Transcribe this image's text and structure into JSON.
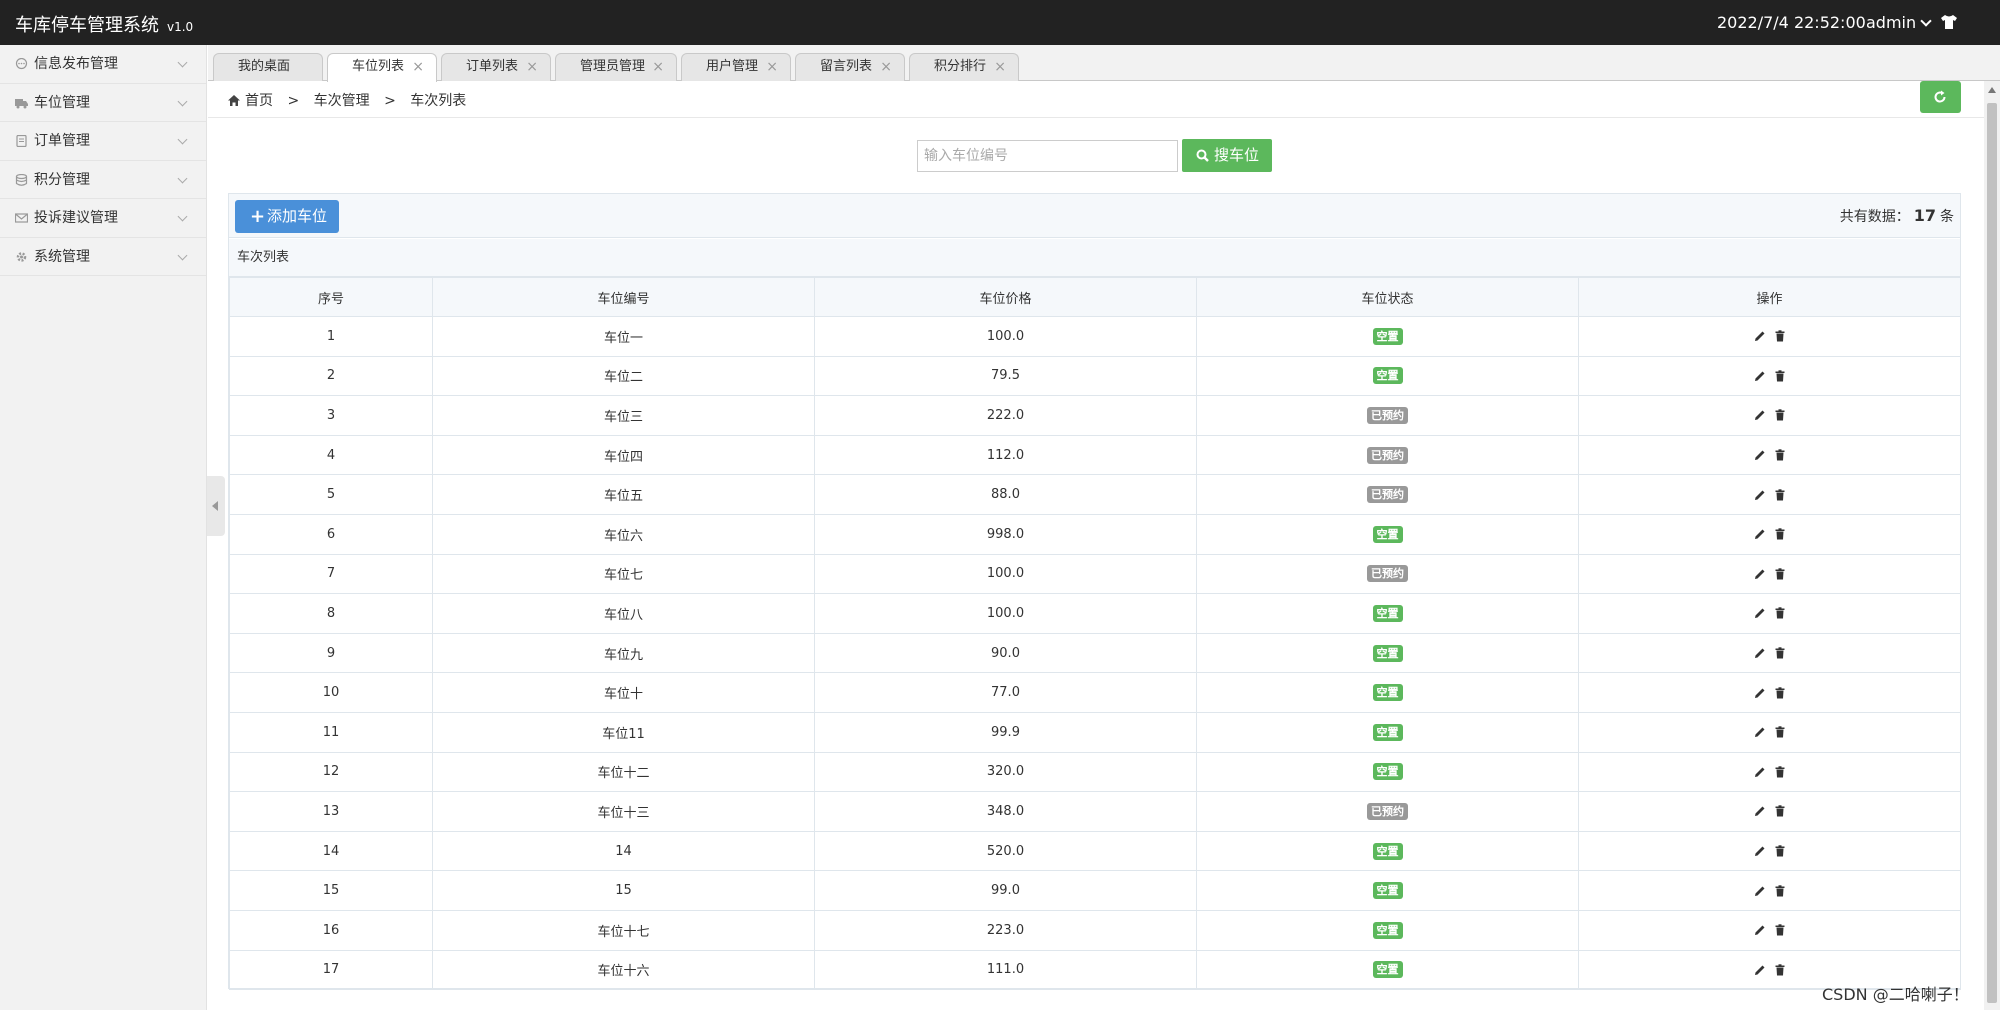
{
  "app": {
    "title": "车库停车管理系统",
    "version": "v1.0",
    "datetime": "2022/7/4 22:52:00",
    "user": "admin"
  },
  "sidebar": {
    "items": [
      {
        "label": "信息发布管理",
        "icon": "chat-icon"
      },
      {
        "label": "车位管理",
        "icon": "truck-icon"
      },
      {
        "label": "订单管理",
        "icon": "document-icon"
      },
      {
        "label": "积分管理",
        "icon": "database-icon"
      },
      {
        "label": "投诉建议管理",
        "icon": "envelope-icon"
      },
      {
        "label": "系统管理",
        "icon": "gear-icon"
      }
    ]
  },
  "tabs": [
    {
      "label": "我的桌面",
      "closable": false
    },
    {
      "label": "车位列表",
      "closable": true,
      "active": true
    },
    {
      "label": "订单列表",
      "closable": true
    },
    {
      "label": "管理员管理",
      "closable": true
    },
    {
      "label": "用户管理",
      "closable": true
    },
    {
      "label": "留言列表",
      "closable": true
    },
    {
      "label": "积分排行",
      "closable": true
    }
  ],
  "breadcrumb": {
    "home": "首页",
    "sep": ">",
    "level2": "车次管理",
    "level3": "车次列表"
  },
  "search": {
    "placeholder": "输入车位编号",
    "button": "搜车位"
  },
  "toolbar": {
    "add_label": "添加车位",
    "count_prefix": "共有数据：",
    "count": "17",
    "count_suffix": "条"
  },
  "table": {
    "title": "车次列表",
    "columns": [
      "序号",
      "车位编号",
      "车位价格",
      "车位状态",
      "操作"
    ],
    "rows": [
      {
        "id": "1",
        "code": "车位一",
        "price": "100.0",
        "status": "空置"
      },
      {
        "id": "2",
        "code": "车位二",
        "price": "79.5",
        "status": "空置"
      },
      {
        "id": "3",
        "code": "车位三",
        "price": "222.0",
        "status": "已预约"
      },
      {
        "id": "4",
        "code": "车位四",
        "price": "112.0",
        "status": "已预约"
      },
      {
        "id": "5",
        "code": "车位五",
        "price": "88.0",
        "status": "已预约"
      },
      {
        "id": "6",
        "code": "车位六",
        "price": "998.0",
        "status": "空置"
      },
      {
        "id": "7",
        "code": "车位七",
        "price": "100.0",
        "status": "已预约"
      },
      {
        "id": "8",
        "code": "车位八",
        "price": "100.0",
        "status": "空置"
      },
      {
        "id": "9",
        "code": "车位九",
        "price": "90.0",
        "status": "空置"
      },
      {
        "id": "10",
        "code": "车位十",
        "price": "77.0",
        "status": "空置"
      },
      {
        "id": "11",
        "code": "车位11",
        "price": "99.9",
        "status": "空置"
      },
      {
        "id": "12",
        "code": "车位十二",
        "price": "320.0",
        "status": "空置"
      },
      {
        "id": "13",
        "code": "车位十三",
        "price": "348.0",
        "status": "已预约"
      },
      {
        "id": "14",
        "code": "14",
        "price": "520.0",
        "status": "空置"
      },
      {
        "id": "15",
        "code": "15",
        "price": "99.0",
        "status": "空置"
      },
      {
        "id": "16",
        "code": "车位十七",
        "price": "223.0",
        "status": "空置"
      },
      {
        "id": "17",
        "code": "车位十六",
        "price": "111.0",
        "status": "空置"
      }
    ]
  },
  "status_colors": {
    "空置": "#5cb85c",
    "已预约": "#999999"
  },
  "colors": {
    "header_bg": "#222222",
    "primary": "#4a90d9",
    "success": "#5cb85c"
  },
  "watermark": "CSDN @二哈喇子！"
}
